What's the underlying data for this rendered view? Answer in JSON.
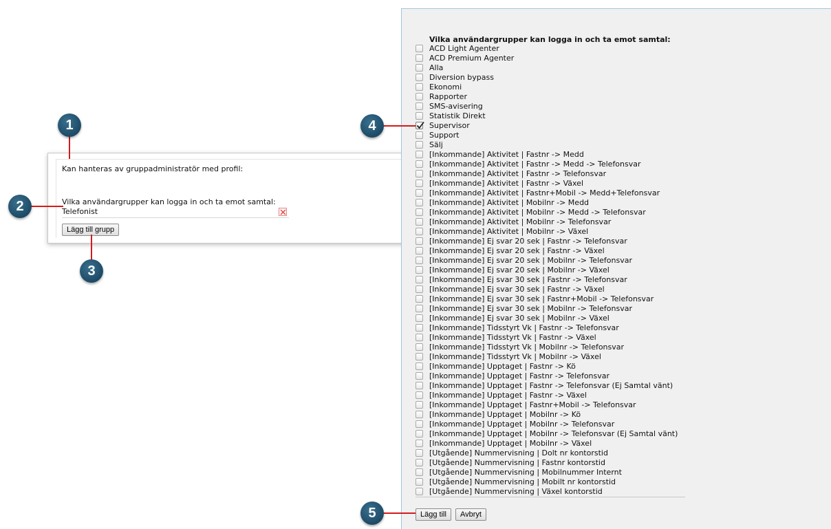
{
  "card": {
    "profile_label": "Kan hanteras av gruppadministratör med profil:",
    "groups_label": "Vilka användargrupper kan logga in och ta emot samtal:",
    "selected_group": "Telefonist",
    "add_group_button": "Lägg till grupp"
  },
  "panel": {
    "heading": "Vilka användargrupper kan logga in och ta emot samtal:",
    "options": [
      {
        "label": "ACD Light Agenter",
        "checked": false
      },
      {
        "label": "ACD Premium Agenter",
        "checked": false
      },
      {
        "label": "Alla",
        "checked": false
      },
      {
        "label": "Diversion bypass",
        "checked": false
      },
      {
        "label": "Ekonomi",
        "checked": false
      },
      {
        "label": "Rapporter",
        "checked": false
      },
      {
        "label": "SMS-avisering",
        "checked": false
      },
      {
        "label": "Statistik Direkt",
        "checked": false
      },
      {
        "label": "Supervisor",
        "checked": true
      },
      {
        "label": "Support",
        "checked": false
      },
      {
        "label": "Sälj",
        "checked": false
      },
      {
        "label": "[Inkommande] Aktivitet | Fastnr -> Medd",
        "checked": false
      },
      {
        "label": "[Inkommande] Aktivitet | Fastnr -> Medd -> Telefonsvar",
        "checked": false
      },
      {
        "label": "[Inkommande] Aktivitet | Fastnr -> Telefonsvar",
        "checked": false
      },
      {
        "label": "[Inkommande] Aktivitet | Fastnr -> Växel",
        "checked": false
      },
      {
        "label": "[Inkommande] Aktivitet | Fastnr+Mobil -> Medd+Telefonsvar",
        "checked": false
      },
      {
        "label": "[Inkommande] Aktivitet | Mobilnr -> Medd",
        "checked": false
      },
      {
        "label": "[Inkommande] Aktivitet | Mobilnr -> Medd -> Telefonsvar",
        "checked": false
      },
      {
        "label": "[Inkommande] Aktivitet | Mobilnr -> Telefonsvar",
        "checked": false
      },
      {
        "label": "[Inkommande] Aktivitet | Mobilnr -> Växel",
        "checked": false
      },
      {
        "label": "[Inkommande] Ej svar 20 sek | Fastnr -> Telefonsvar",
        "checked": false
      },
      {
        "label": "[Inkommande] Ej svar 20 sek | Fastnr -> Växel",
        "checked": false
      },
      {
        "label": "[Inkommande] Ej svar 20 sek | Mobilnr -> Telefonsvar",
        "checked": false
      },
      {
        "label": "[Inkommande] Ej svar 20 sek | Mobilnr -> Växel",
        "checked": false
      },
      {
        "label": "[Inkommande] Ej svar 30 sek | Fastnr -> Telefonsvar",
        "checked": false
      },
      {
        "label": "[Inkommande] Ej svar 30 sek | Fastnr -> Växel",
        "checked": false
      },
      {
        "label": "[Inkommande] Ej svar 30 sek | Fastnr+Mobil -> Telefonsvar",
        "checked": false
      },
      {
        "label": "[Inkommande] Ej svar 30 sek | Mobilnr -> Telefonsvar",
        "checked": false
      },
      {
        "label": "[Inkommande] Ej svar 30 sek | Mobilnr -> Växel",
        "checked": false
      },
      {
        "label": "[Inkommande] Tidsstyrt Vk | Fastnr -> Telefonsvar",
        "checked": false
      },
      {
        "label": "[Inkommande] Tidsstyrt Vk | Fastnr -> Växel",
        "checked": false
      },
      {
        "label": "[Inkommande] Tidsstyrt Vk | Mobilnr -> Telefonsvar",
        "checked": false
      },
      {
        "label": "[Inkommande] Tidsstyrt Vk | Mobilnr -> Växel",
        "checked": false
      },
      {
        "label": "[Inkommande] Upptaget | Fastnr -> Kö",
        "checked": false
      },
      {
        "label": "[Inkommande] Upptaget | Fastnr -> Telefonsvar",
        "checked": false
      },
      {
        "label": "[Inkommande] Upptaget | Fastnr -> Telefonsvar (Ej Samtal vänt)",
        "checked": false
      },
      {
        "label": "[Inkommande] Upptaget | Fastnr -> Växel",
        "checked": false
      },
      {
        "label": "[Inkommande] Upptaget | Fastnr+Mobil -> Telefonsvar",
        "checked": false
      },
      {
        "label": "[Inkommande] Upptaget | Mobilnr -> Kö",
        "checked": false
      },
      {
        "label": "[Inkommande] Upptaget | Mobilnr -> Telefonsvar",
        "checked": false
      },
      {
        "label": "[Inkommande] Upptaget | Mobilnr -> Telefonsvar (Ej Samtal vänt)",
        "checked": false
      },
      {
        "label": "[Inkommande] Upptaget | Mobilnr -> Växel",
        "checked": false
      },
      {
        "label": "[Utgående] Nummervisning | Dolt nr kontorstid",
        "checked": false
      },
      {
        "label": "[Utgående] Nummervisning | Fastnr kontorstid",
        "checked": false
      },
      {
        "label": "[Utgående] Nummervisning | Mobilnummer Internt",
        "checked": false
      },
      {
        "label": "[Utgående] Nummervisning | Mobilt nr kontorstid",
        "checked": false
      },
      {
        "label": "[Utgående] Nummervisning | Växel kontorstid",
        "checked": false
      }
    ],
    "add_button": "Lägg till",
    "cancel_button": "Avbryt"
  },
  "callouts": [
    "1",
    "2",
    "3",
    "4",
    "5"
  ],
  "icons": {
    "remove": "remove-x-icon",
    "check": "checkmark-icon"
  },
  "colors": {
    "callout": "#1d4a66",
    "callout_line": "#d41a1a",
    "panel_bg": "#f0f0f0",
    "panel_border": "#9fc6dc"
  }
}
